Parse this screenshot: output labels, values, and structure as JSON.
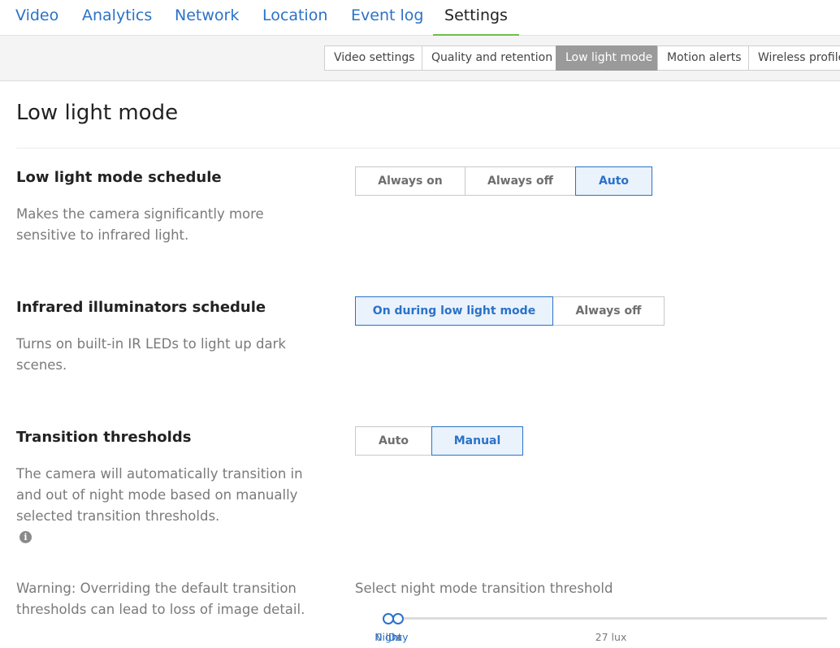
{
  "top_nav": {
    "tabs": [
      {
        "label": "Video"
      },
      {
        "label": "Analytics"
      },
      {
        "label": "Network"
      },
      {
        "label": "Location"
      },
      {
        "label": "Event log"
      },
      {
        "label": "Settings",
        "active": true
      }
    ]
  },
  "sub_nav": {
    "tabs": [
      {
        "label": "Video settings"
      },
      {
        "label": "Quality and retention"
      },
      {
        "label": "Low light mode",
        "active": true
      },
      {
        "label": "Motion alerts"
      },
      {
        "label": "Wireless profiles"
      }
    ]
  },
  "page": {
    "title": "Low light mode"
  },
  "sections": [
    {
      "title": "Low light mode schedule",
      "description": "Makes the camera significantly more sensitive to infrared light.",
      "options": [
        "Always on",
        "Always off",
        "Auto"
      ],
      "selected": "Auto"
    },
    {
      "title": "Infrared illuminators schedule",
      "description": "Turns on built-in IR LEDs to light up dark scenes.",
      "options": [
        "On during low light mode",
        "Always off"
      ],
      "selected": "On during low light mode"
    },
    {
      "title": "Transition thresholds",
      "description": "The camera will automatically transition in and out of night mode based on manually selected transition thresholds.",
      "options": [
        "Auto",
        "Manual"
      ],
      "selected": "Manual",
      "info_icon": "info-icon"
    }
  ],
  "threshold": {
    "warning": "Warning: Overriding the default transition thresholds can lead to loss of image detail.",
    "label": "Select night mode transition threshold",
    "min_label": "0 lux",
    "max_label": "27 lux",
    "night_label": "Night",
    "day_label": "Day",
    "min_lux": 0,
    "max_lux": 27,
    "night_value": 0,
    "day_value": 1.2
  },
  "colors": {
    "accent": "#2a72c8",
    "active_tab_underline": "#6cc04a",
    "active_subtab_bg": "#9a9a9a"
  }
}
